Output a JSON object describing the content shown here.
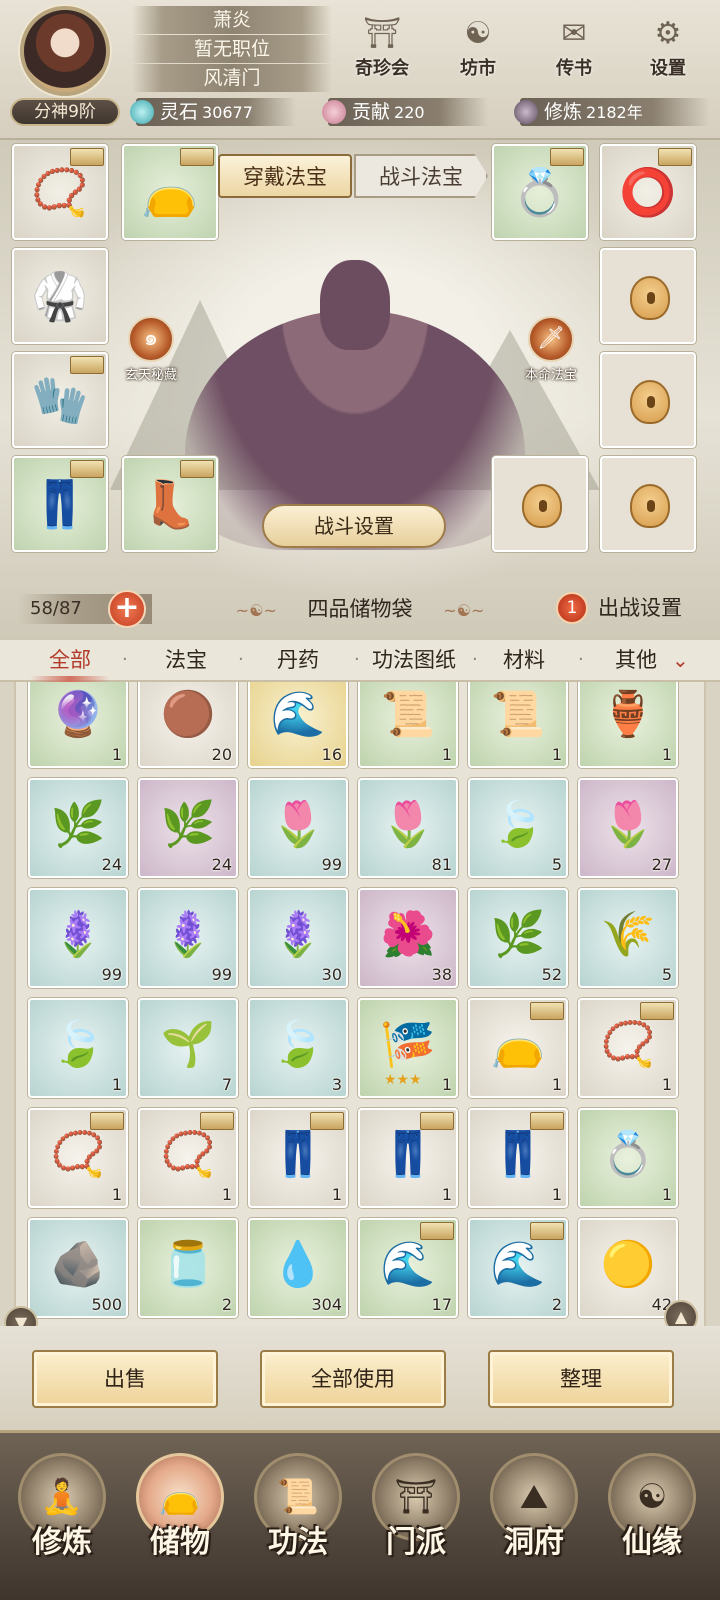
{
  "player": {
    "name": "萧炎",
    "position": "暂无职位",
    "sect": "风清门",
    "rank": "分神9阶"
  },
  "top_menu": [
    {
      "label": "奇珍会",
      "icon": "pavilion-icon",
      "glyph": "⛩"
    },
    {
      "label": "坊市",
      "icon": "yin-yang-shop-icon",
      "glyph": "☯"
    },
    {
      "label": "传书",
      "icon": "scroll-letter-icon",
      "glyph": "✉"
    },
    {
      "label": "设置",
      "icon": "gear-icon",
      "glyph": "⚙"
    }
  ],
  "resources": [
    {
      "name": "灵石",
      "value": "30677",
      "color": "#5fc4c9"
    },
    {
      "name": "贡献",
      "value": "220",
      "color": "#d58ea0"
    },
    {
      "name": "修炼",
      "value": "2182年",
      "color": "#7a6a7a"
    }
  ],
  "equip": {
    "tab_active": "穿戴法宝",
    "tab_inactive": "战斗法宝",
    "left_orb_label": "玄天秘藏",
    "right_orb_label": "本命法宝",
    "battle_settings": "战斗设置"
  },
  "bag": {
    "capacity": "58/87",
    "title": "四品储物袋",
    "deploy_count": "1",
    "deploy_label": "出战设置"
  },
  "categories": [
    "全部",
    "法宝",
    "丹药",
    "功法图纸",
    "材料",
    "其他"
  ],
  "inventory": [
    {
      "icon": "pearl-icon",
      "glyph": "🔮",
      "count": "1",
      "bg": "green",
      "tag": false
    },
    {
      "icon": "bronze-orb-icon",
      "glyph": "🟤",
      "count": "20",
      "bg": "white",
      "tag": false
    },
    {
      "icon": "water-wave-icon",
      "glyph": "🌊",
      "count": "16",
      "bg": "gold",
      "tag": false
    },
    {
      "icon": "scroll-icon",
      "glyph": "📜",
      "count": "1",
      "bg": "green",
      "tag": false
    },
    {
      "icon": "scroll-icon",
      "glyph": "📜",
      "count": "1",
      "bg": "green",
      "tag": false
    },
    {
      "icon": "vase-icon",
      "glyph": "🏺",
      "count": "1",
      "bg": "green",
      "tag": false
    },
    {
      "icon": "herb-icon",
      "glyph": "🌿",
      "count": "24",
      "bg": "blue",
      "tag": false
    },
    {
      "icon": "herb-icon",
      "glyph": "🌿",
      "count": "24",
      "bg": "purple",
      "tag": false
    },
    {
      "icon": "bellflower-icon",
      "glyph": "🌷",
      "count": "99",
      "bg": "blue",
      "tag": false
    },
    {
      "icon": "bellflower-icon",
      "glyph": "🌷",
      "count": "81",
      "bg": "blue",
      "tag": false
    },
    {
      "icon": "lotus-leaf-icon",
      "glyph": "🍃",
      "count": "5",
      "bg": "blue",
      "tag": false
    },
    {
      "icon": "bellflower-icon",
      "glyph": "🌷",
      "count": "27",
      "bg": "purple",
      "tag": false
    },
    {
      "icon": "purple-flower-icon",
      "glyph": "🪻",
      "count": "99",
      "bg": "blue",
      "tag": false
    },
    {
      "icon": "purple-flower-icon",
      "glyph": "🪻",
      "count": "99",
      "bg": "blue",
      "tag": false
    },
    {
      "icon": "purple-flower-icon",
      "glyph": "🪻",
      "count": "30",
      "bg": "blue",
      "tag": false
    },
    {
      "icon": "glowing-flower-icon",
      "glyph": "🌺",
      "count": "38",
      "bg": "purple",
      "tag": false
    },
    {
      "icon": "blue-fern-icon",
      "glyph": "🌿",
      "count": "52",
      "bg": "blue",
      "tag": false
    },
    {
      "icon": "dry-grass-icon",
      "glyph": "🌾",
      "count": "5",
      "bg": "blue",
      "tag": false
    },
    {
      "icon": "lotus-leaf-icon",
      "glyph": "🍃",
      "count": "1",
      "bg": "blue",
      "tag": false
    },
    {
      "icon": "shrub-icon",
      "glyph": "🌱",
      "count": "7",
      "bg": "blue",
      "tag": false
    },
    {
      "icon": "lotus-leaf-icon",
      "glyph": "🍃",
      "count": "3",
      "bg": "blue",
      "tag": false
    },
    {
      "icon": "blue-banner-icon",
      "glyph": "🎏",
      "count": "1",
      "bg": "green",
      "tag": false,
      "stars": "★★★"
    },
    {
      "icon": "pouch-icon",
      "glyph": "👝",
      "count": "1",
      "bg": "white",
      "tag": true
    },
    {
      "icon": "necklace-icon",
      "glyph": "📿",
      "count": "1",
      "bg": "white",
      "tag": true
    },
    {
      "icon": "necklace-icon",
      "glyph": "📿",
      "count": "1",
      "bg": "white",
      "tag": true
    },
    {
      "icon": "necklace-icon",
      "glyph": "📿",
      "count": "1",
      "bg": "white",
      "tag": true
    },
    {
      "icon": "pants-icon",
      "glyph": "👖",
      "count": "1",
      "bg": "white",
      "tag": true
    },
    {
      "icon": "pants-icon",
      "glyph": "👖",
      "count": "1",
      "bg": "white",
      "tag": true
    },
    {
      "icon": "pants-icon",
      "glyph": "👖",
      "count": "1",
      "bg": "white",
      "tag": true
    },
    {
      "icon": "ring-icon",
      "glyph": "💍",
      "count": "1",
      "bg": "green",
      "tag": false
    },
    {
      "icon": "ore-icon",
      "glyph": "🪨",
      "count": "500",
      "bg": "blue",
      "tag": false
    },
    {
      "icon": "gourd-icon",
      "glyph": "🫙",
      "count": "2",
      "bg": "green",
      "tag": false
    },
    {
      "icon": "water-drop-icon",
      "glyph": "💧",
      "count": "304",
      "bg": "green",
      "tag": false
    },
    {
      "icon": "water-wave-icon",
      "glyph": "🌊",
      "count": "17",
      "bg": "green",
      "tag": true
    },
    {
      "icon": "water-wave-icon",
      "glyph": "🌊",
      "count": "2",
      "bg": "blue",
      "tag": true
    },
    {
      "icon": "golden-orb-icon",
      "glyph": "🟡",
      "count": "42",
      "bg": "white",
      "tag": false
    }
  ],
  "actions": {
    "sell": "出售",
    "use_all": "全部使用",
    "sort": "整理"
  },
  "nav": [
    {
      "label": "修炼",
      "icon": "cultivation-icon",
      "glyph": "🧘",
      "active": false
    },
    {
      "label": "储物",
      "icon": "storage-bag-icon",
      "glyph": "👝",
      "active": true
    },
    {
      "label": "功法",
      "icon": "technique-scroll-icon",
      "glyph": "📜",
      "active": false
    },
    {
      "label": "门派",
      "icon": "sect-gate-icon",
      "glyph": "⛩",
      "active": false
    },
    {
      "label": "洞府",
      "icon": "cave-mountain-icon",
      "glyph": "⛰",
      "active": false
    },
    {
      "label": "仙缘",
      "icon": "immortal-fate-icon",
      "glyph": "☯",
      "active": false
    }
  ]
}
